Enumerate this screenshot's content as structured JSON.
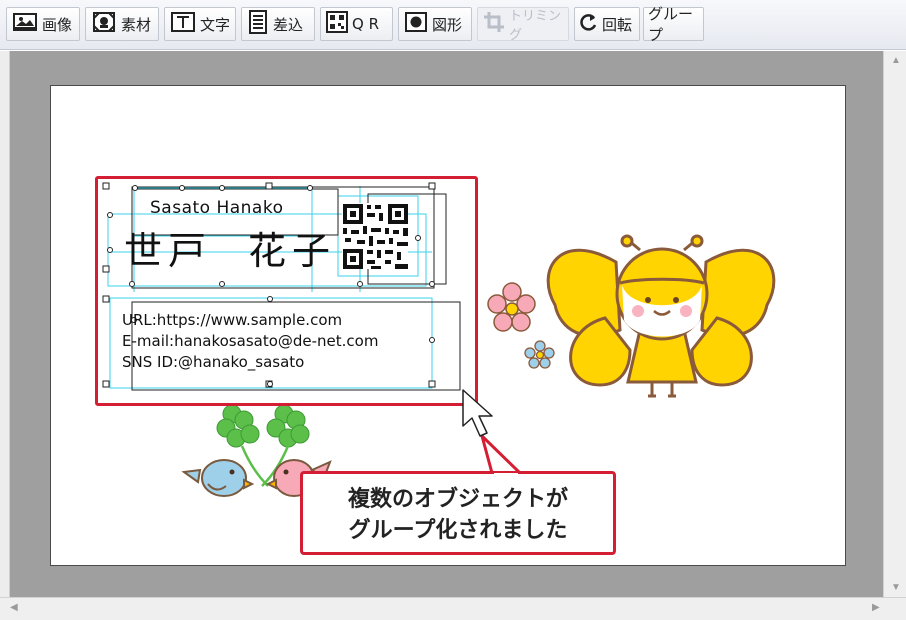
{
  "toolbar": {
    "buttons": [
      {
        "label": "画像",
        "icon": "image-icon"
      },
      {
        "label": "素材",
        "icon": "material-icon"
      },
      {
        "label": "文字",
        "icon": "text-icon"
      },
      {
        "label": "差込",
        "icon": "insert-icon"
      },
      {
        "label": "Q R",
        "icon": "qr-icon"
      },
      {
        "label": "図形",
        "icon": "shape-icon"
      },
      {
        "label": "トリミング",
        "icon": "crop-icon",
        "disabled": true
      },
      {
        "label": "回転",
        "icon": "rotate-icon"
      },
      {
        "label": "グループ",
        "icon": ""
      }
    ]
  },
  "card": {
    "name_en": "Sasato Hanako",
    "name_jp_family": "世戸",
    "name_jp_given": "花子",
    "url_line": "URL:https://www.sample.com",
    "email_line": "E-mail:hanakosasato@de-net.com",
    "sns_line": "SNS ID:@hanako_sasato"
  },
  "callout": {
    "line1": "複数のオブジェクトが",
    "line2": "グループ化されました"
  },
  "colors": {
    "accent_red": "#d41e34",
    "selection_cyan": "#39d2e8",
    "butterfly_yellow": "#ffd400",
    "clover_green": "#5bbf4a"
  }
}
